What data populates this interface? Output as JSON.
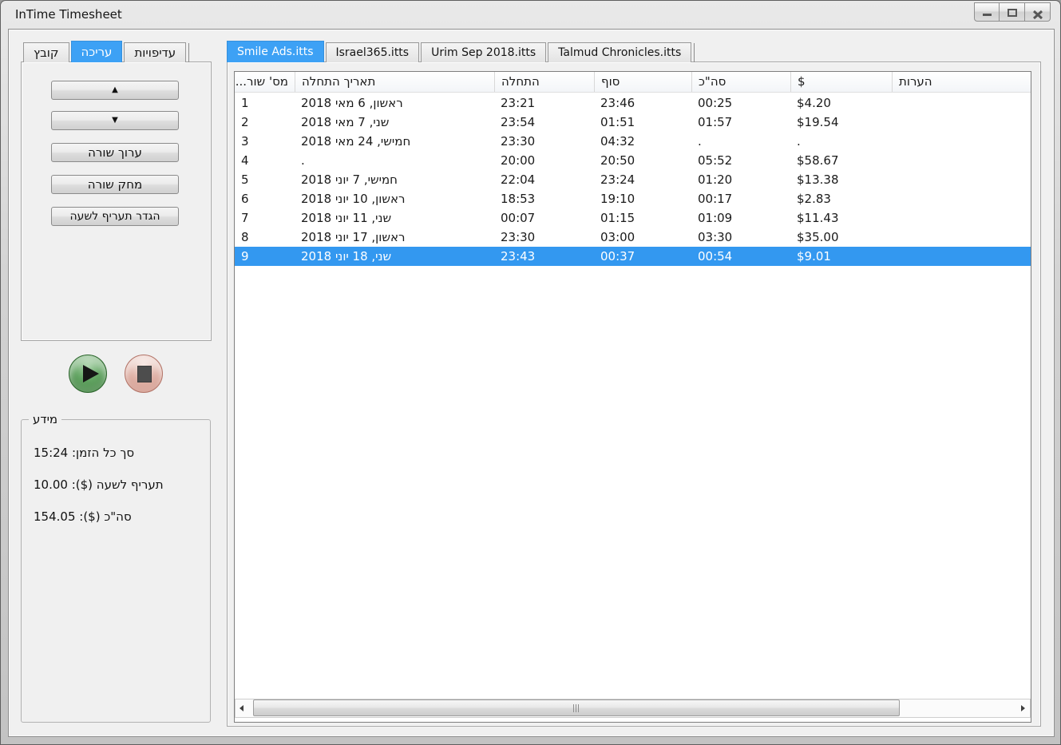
{
  "window": {
    "title": "InTime Timesheet",
    "controls": {
      "minimize": "minimize",
      "maximize": "maximize",
      "close": "close"
    }
  },
  "colors": {
    "tab_selected_blue": "#3da1f5",
    "row_selection_blue": "#3398f0",
    "play_green": "#357d35",
    "stop_pink": "#c98575",
    "background_gray": "#f0f0f0"
  },
  "icons": {
    "minimize": "minimize-dash",
    "maximize": "maximize-square",
    "close": "close-x",
    "play": "play-triangle",
    "stop": "stop-square",
    "scroll_left": "left-arrow",
    "scroll_right": "right-arrow"
  },
  "left_panel": {
    "tabs": [
      {
        "label": "קובץ",
        "selected": false
      },
      {
        "label": "עריכה",
        "selected": true
      },
      {
        "label": "עדיפויות",
        "selected": false
      }
    ],
    "buttons": [
      {
        "id": "move-row-up",
        "label": "▲"
      },
      {
        "id": "move-row-down",
        "label": "▼"
      },
      {
        "id": "edit-row",
        "label": "ערוך שורה"
      },
      {
        "id": "delete-row",
        "label": "מחק שורה"
      },
      {
        "id": "set-hourly-rate",
        "label": "הגדר תעריף לשעה"
      }
    ],
    "info": {
      "group_label": "מידע",
      "lines": [
        "סך כל הזמן: 15:24",
        "תעריף לשעה ($): 10.00",
        "סה\"כ ($): 154.05"
      ]
    }
  },
  "main": {
    "tabs": [
      {
        "label": "Smile Ads.itts",
        "selected": true
      },
      {
        "label": "Israel365.itts",
        "selected": false
      },
      {
        "label": "Urim Sep 2018.itts",
        "selected": false
      },
      {
        "label": "Talmud Chronicles.itts",
        "selected": false
      }
    ],
    "table": {
      "columns": [
        "מס' שור...",
        "תאריך התחלה",
        "התחלה",
        "סוף",
        "סה\"כ",
        "$",
        "הערות"
      ],
      "rows": [
        {
          "num": "1",
          "date": "ראשון, 6 מאי 2018",
          "start": "23:21",
          "end": "23:46",
          "total": "00:25",
          "amount": "$4.20",
          "notes": "",
          "selected": false
        },
        {
          "num": "2",
          "date": "שני, 7 מאי 2018",
          "start": "23:54",
          "end": "01:51",
          "total": "01:57",
          "amount": "$19.54",
          "notes": "",
          "selected": false
        },
        {
          "num": "3",
          "date": "חמישי, 24 מאי 2018",
          "start": "23:30",
          "end": "04:32",
          "total": ".",
          "amount": ".",
          "notes": "",
          "selected": false
        },
        {
          "num": "4",
          "date": ".",
          "start": "20:00",
          "end": "20:50",
          "total": "05:52",
          "amount": "$58.67",
          "notes": "",
          "selected": false
        },
        {
          "num": "5",
          "date": "חמישי, 7 יוני 2018",
          "start": "22:04",
          "end": "23:24",
          "total": "01:20",
          "amount": "$13.38",
          "notes": "",
          "selected": false
        },
        {
          "num": "6",
          "date": "ראשון, 10 יוני 2018",
          "start": "18:53",
          "end": "19:10",
          "total": "00:17",
          "amount": "$2.83",
          "notes": "",
          "selected": false
        },
        {
          "num": "7",
          "date": "שני, 11 יוני 2018",
          "start": "00:07",
          "end": "01:15",
          "total": "01:09",
          "amount": "$11.43",
          "notes": "",
          "selected": false
        },
        {
          "num": "8",
          "date": "ראשון, 17 יוני 2018",
          "start": "23:30",
          "end": "03:00",
          "total": "03:30",
          "amount": "$35.00",
          "notes": "",
          "selected": false
        },
        {
          "num": "9",
          "date": "שני, 18 יוני 2018",
          "start": "23:43",
          "end": "00:37",
          "total": "00:54",
          "amount": "$9.01",
          "notes": "",
          "selected": true
        }
      ]
    }
  }
}
